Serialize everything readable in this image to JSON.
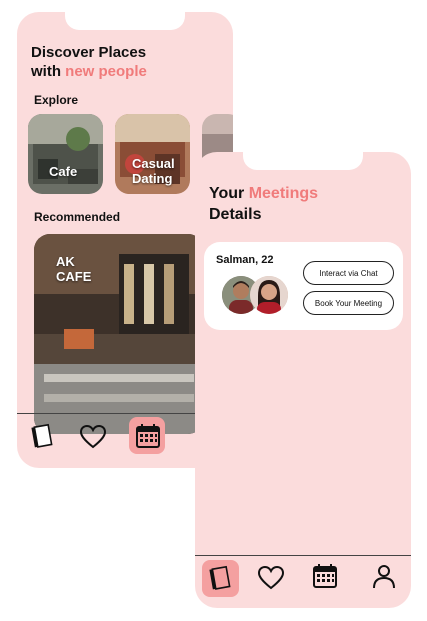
{
  "left_screen": {
    "heading_line1": "Discover Places",
    "heading_line2_prefix": "with ",
    "heading_line2_accent": "new people",
    "explore_label": "Explore",
    "explore_items": [
      {
        "label": "Cafe"
      },
      {
        "label": "Casual Dating"
      }
    ],
    "recommended_label": "Recommended",
    "recommended_item": {
      "line1": "AK",
      "line2": "CAFE"
    },
    "nav": [
      {
        "icon": "notebook-icon",
        "active": false
      },
      {
        "icon": "heart-icon",
        "active": false
      },
      {
        "icon": "calendar-icon",
        "active": true
      }
    ]
  },
  "right_screen": {
    "heading_prefix": "Your ",
    "heading_accent": "Meetings",
    "heading_line2": "Details",
    "meeting_card": {
      "name": "Salman, 22",
      "chat_button": "Interact via Chat",
      "book_button": "Book Your Meeting"
    },
    "nav": [
      {
        "icon": "notebook-icon",
        "active": true
      },
      {
        "icon": "heart-icon",
        "active": false
      },
      {
        "icon": "calendar-icon",
        "active": false
      },
      {
        "icon": "person-icon",
        "active": false
      }
    ]
  },
  "colors": {
    "screen_bg": "#fbdcdc",
    "accent": "#f07b7b",
    "active_nav": "#f4a0a0"
  }
}
